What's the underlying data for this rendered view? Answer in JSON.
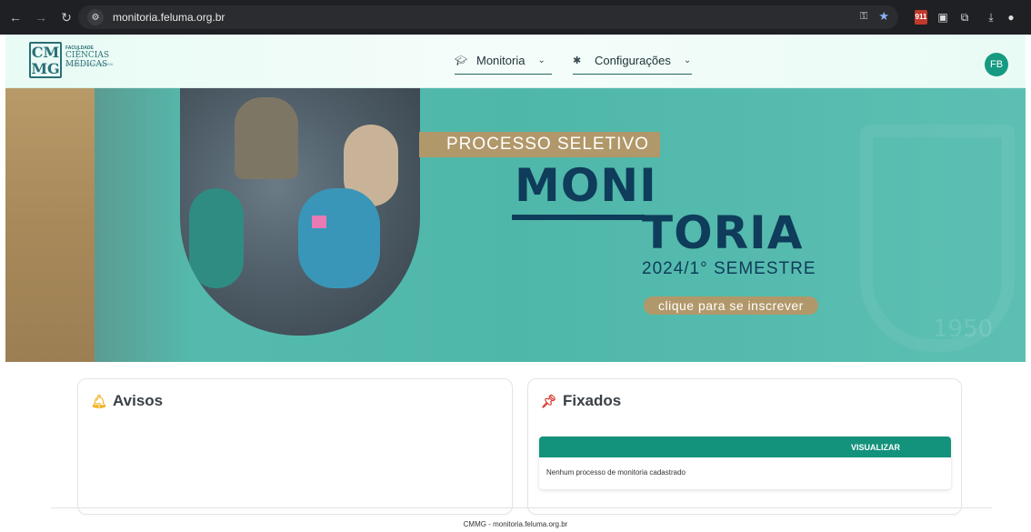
{
  "browser": {
    "url": "monitoria.feluma.org.br",
    "calendar_badge": "911"
  },
  "header": {
    "logo": {
      "line1": "FACULDADE",
      "line2": "CIÊNCIAS MÉDICAS",
      "line3": "UMA INSTITUIÇÃO FELUMA"
    },
    "menus": [
      {
        "label": "Monitoria",
        "icon": "graduation-cap-icon"
      },
      {
        "label": "Configurações",
        "icon": "gear-icon"
      }
    ],
    "avatar_initials": "FB"
  },
  "banner": {
    "tag": "PROCESSO SELETIVO",
    "title_line1": "MONI",
    "title_line2": "TORIA",
    "semester": "2024/1° SEMESTRE",
    "cta": "clique para se inscrever",
    "watermark_year": "1950"
  },
  "avisos": {
    "title": "Avisos"
  },
  "fixados": {
    "title": "Fixados",
    "table_header": "VISUALIZAR",
    "empty_message": "Nenhum processo de monitoria cadastrado"
  },
  "footer": {
    "text": "CMMG - monitoria.feluma.org.br"
  },
  "colors": {
    "teal": "#13927c",
    "navy": "#0f3c5a",
    "gold": "#b1986a",
    "banner_bg": "#4fb7aa"
  }
}
